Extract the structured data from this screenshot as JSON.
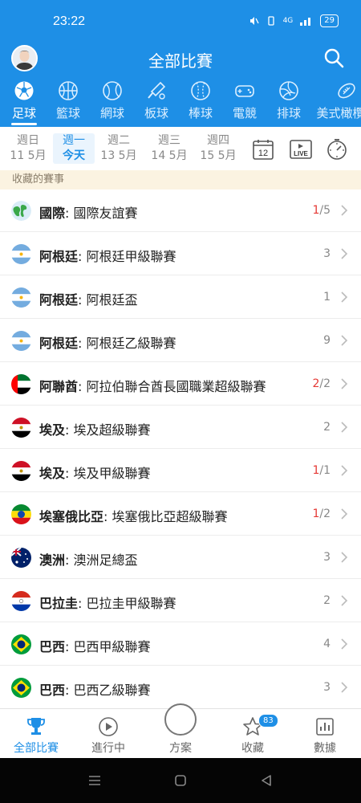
{
  "status_bar": {
    "time": "23:22",
    "battery": "29",
    "signal": "4G"
  },
  "header": {
    "title": "全部比賽"
  },
  "sport_tabs": [
    {
      "label": "足球",
      "icon": "soccer-ball-icon",
      "active": true
    },
    {
      "label": "籃球",
      "icon": "basketball-icon",
      "active": false
    },
    {
      "label": "網球",
      "icon": "tennis-ball-icon",
      "active": false
    },
    {
      "label": "板球",
      "icon": "cricket-bat-icon",
      "active": false
    },
    {
      "label": "棒球",
      "icon": "baseball-icon",
      "active": false
    },
    {
      "label": "電競",
      "icon": "gamepad-icon",
      "active": false
    },
    {
      "label": "排球",
      "icon": "volleyball-icon",
      "active": false
    },
    {
      "label": "美式橄欖球",
      "icon": "american-football-icon",
      "active": false
    }
  ],
  "dates": [
    {
      "weekday": "週日",
      "date": "11 5月",
      "active": false
    },
    {
      "weekday": "週一",
      "date": "今天",
      "active": true
    },
    {
      "weekday": "週二",
      "date": "13 5月",
      "active": false
    },
    {
      "weekday": "週三",
      "date": "14 5月",
      "active": false
    },
    {
      "weekday": "週四",
      "date": "15 5月",
      "active": false
    }
  ],
  "date_tools": {
    "calendar_day": "12",
    "live_label": "LIVE"
  },
  "section": {
    "title": "收藏的賽事"
  },
  "leagues": [
    {
      "country": "國際",
      "name": "國際友誼賽",
      "live": "1",
      "total": "/5",
      "count": "",
      "flag": "world"
    },
    {
      "country": "阿根廷",
      "name": "阿根廷甲級聯賽",
      "live": "",
      "total": "",
      "count": "3",
      "flag": "argentina"
    },
    {
      "country": "阿根廷",
      "name": "阿根廷盃",
      "live": "",
      "total": "",
      "count": "1",
      "flag": "argentina"
    },
    {
      "country": "阿根廷",
      "name": "阿根廷乙級聯賽",
      "live": "",
      "total": "",
      "count": "9",
      "flag": "argentina"
    },
    {
      "country": "阿聯酋",
      "name": "阿拉伯聯合酋長國職業超級聯賽",
      "live": "2",
      "total": "/2",
      "count": "",
      "flag": "uae"
    },
    {
      "country": "埃及",
      "name": "埃及超級聯賽",
      "live": "",
      "total": "",
      "count": "2",
      "flag": "egypt"
    },
    {
      "country": "埃及",
      "name": "埃及甲級聯賽",
      "live": "1",
      "total": "/1",
      "count": "",
      "flag": "egypt"
    },
    {
      "country": "埃塞俄比亞",
      "name": "埃塞俄比亞超級聯賽",
      "live": "1",
      "total": "/2",
      "count": "",
      "flag": "ethiopia"
    },
    {
      "country": "澳洲",
      "name": "澳洲足總盃",
      "live": "",
      "total": "",
      "count": "3",
      "flag": "australia"
    },
    {
      "country": "巴拉圭",
      "name": "巴拉圭甲級聯賽",
      "live": "",
      "total": "",
      "count": "2",
      "flag": "paraguay"
    },
    {
      "country": "巴西",
      "name": "巴西甲級聯賽",
      "live": "",
      "total": "",
      "count": "4",
      "flag": "brazil"
    },
    {
      "country": "巴西",
      "name": "巴西乙級聯賽",
      "live": "",
      "total": "",
      "count": "3",
      "flag": "brazil"
    }
  ],
  "bottom_nav": [
    {
      "label": "全部比賽",
      "icon": "trophy-icon",
      "active": true
    },
    {
      "label": "進行中",
      "icon": "play-circle-icon",
      "active": false
    },
    {
      "label": "方案",
      "icon": "document-icon",
      "active": false
    },
    {
      "label": "收藏",
      "icon": "star-icon",
      "active": false,
      "badge": "83"
    },
    {
      "label": "數據",
      "icon": "bar-chart-icon",
      "active": false
    }
  ],
  "colors": {
    "primary": "#1e8fe6",
    "live": "#e53935",
    "section_bg": "#fbf3e1"
  }
}
